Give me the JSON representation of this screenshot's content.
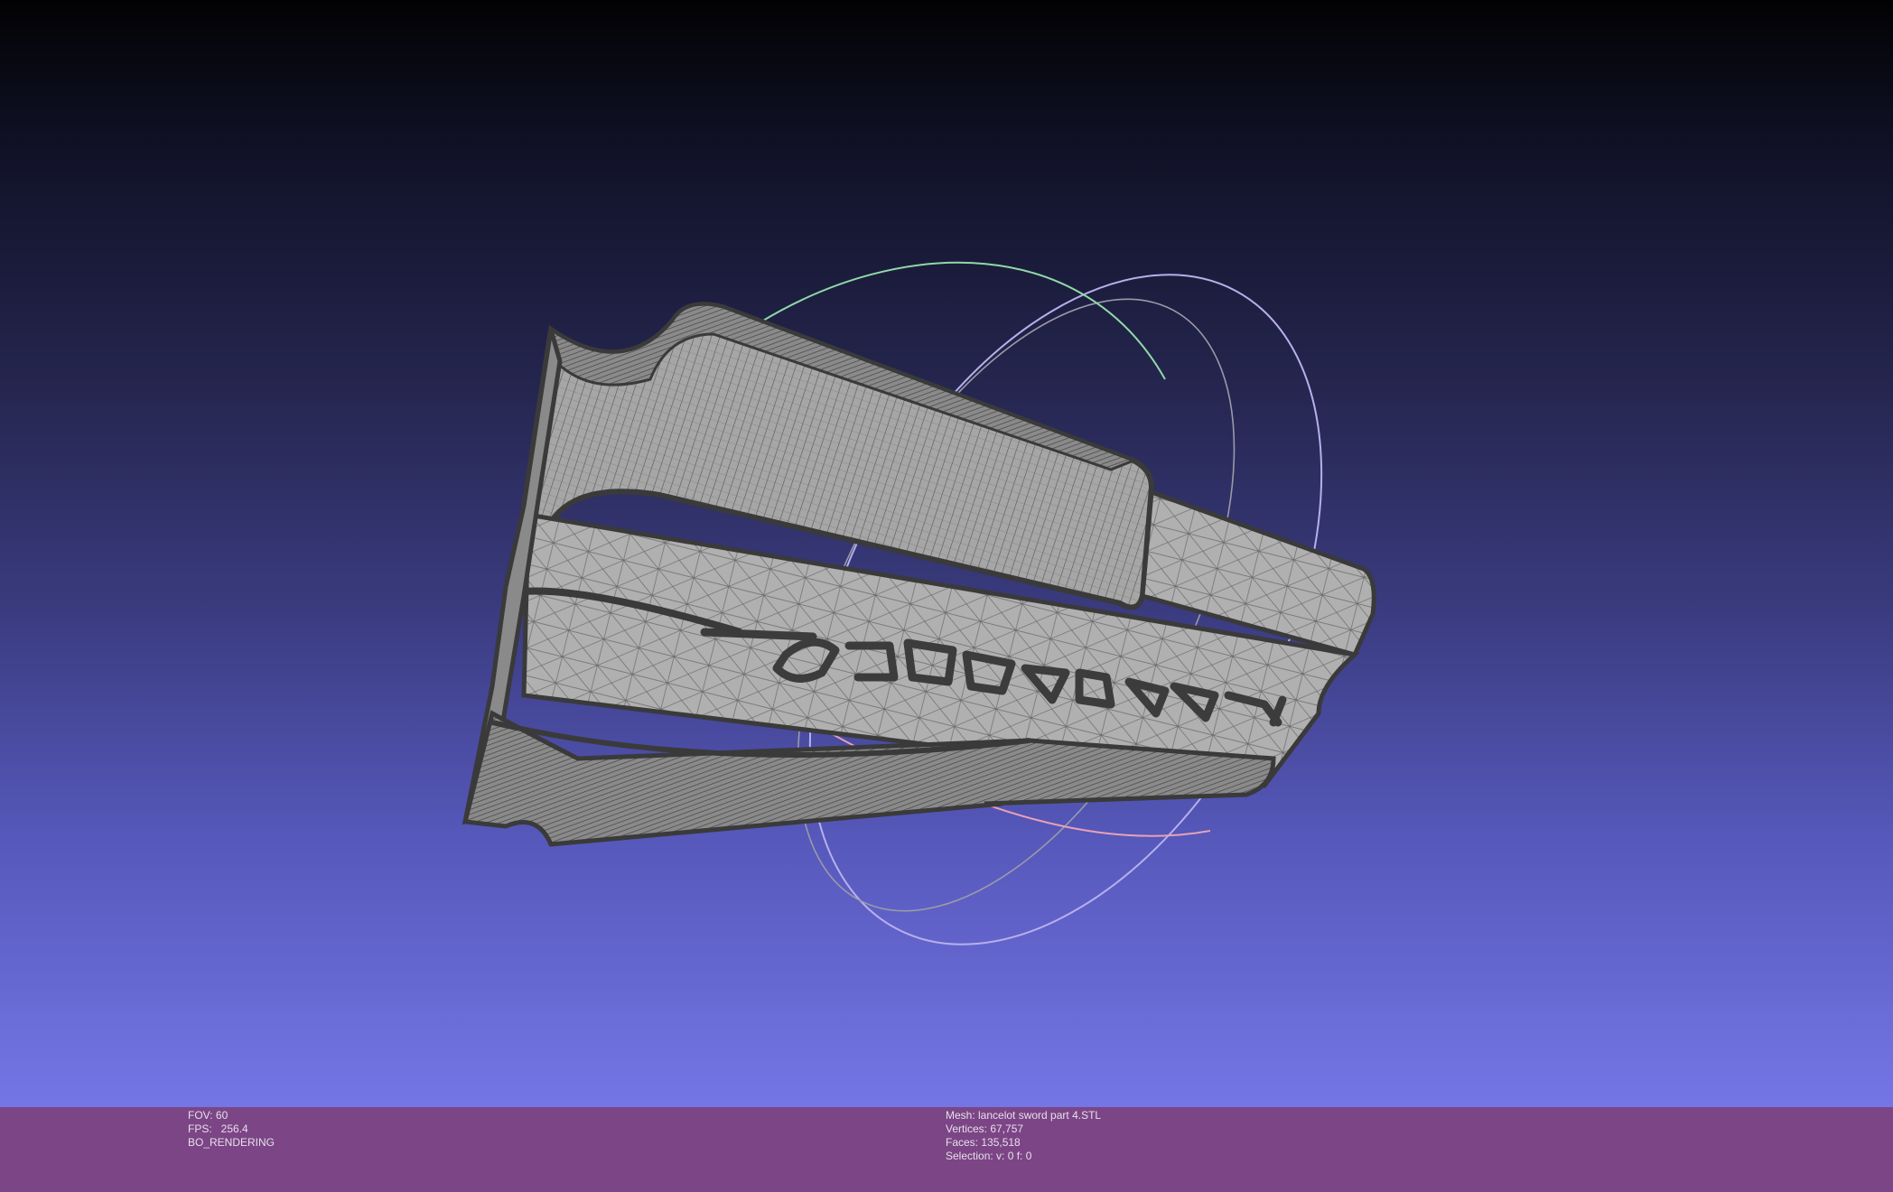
{
  "status_bar": {
    "left": {
      "fov_label": "FOV: 60",
      "fps_label": "FPS:   256.4",
      "render_mode": "BO_RENDERING"
    },
    "right": {
      "mesh_label": "Mesh: lancelot sword part 4.STL",
      "vertices_label": "Vertices: 67,757",
      "faces_label": "Faces: 135,518",
      "selection_label": "Selection: v: 0 f: 0"
    }
  },
  "viewport": {
    "background_top": "#020204",
    "background_bottom": "#7476e6",
    "mesh_fill": "#a9a9a9",
    "mesh_wire": "#4a4a4a",
    "trackball_colors": [
      "#8fd9a8",
      "#b8b0e8",
      "#e8a0b8",
      "#9a9aa8"
    ]
  }
}
